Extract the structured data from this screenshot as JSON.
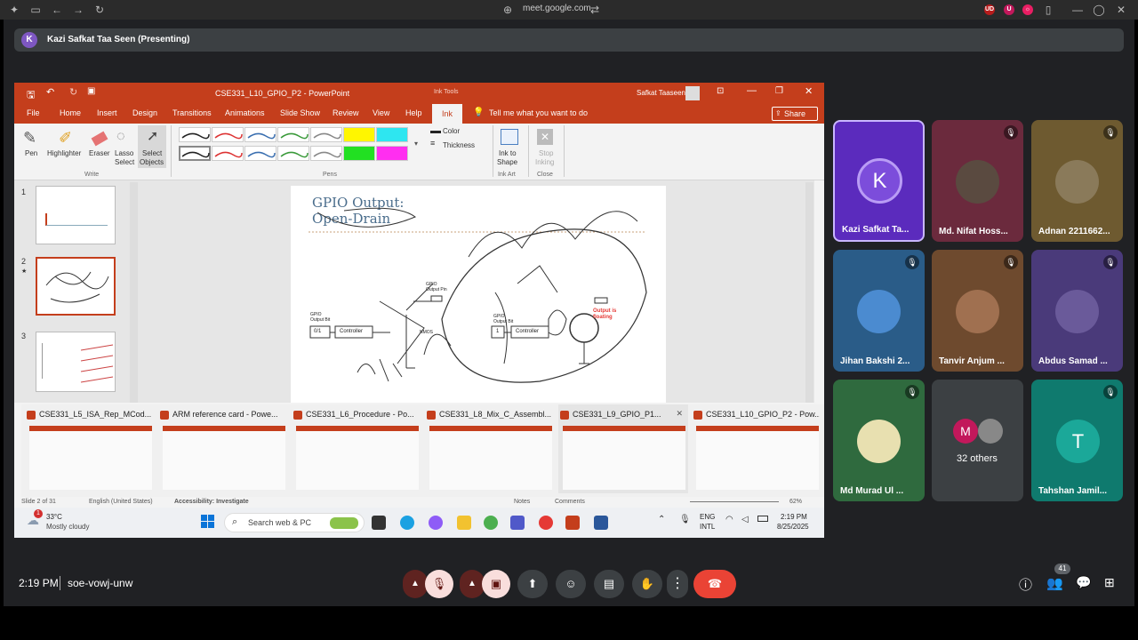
{
  "browser": {
    "url": "meet.google.com"
  },
  "meet": {
    "presenter": {
      "initial": "K",
      "label": "Kazi Safkat Taa Seen (Presenting)"
    },
    "participants": [
      {
        "name": "Kazi Safkat Ta...",
        "initial": "K"
      },
      {
        "name": "Md. Nifat Hoss..."
      },
      {
        "name": "Adnan 2211662..."
      },
      {
        "name": "Jihan Bakshi 2..."
      },
      {
        "name": "Tanvir Anjum ..."
      },
      {
        "name": "Abdus Samad ..."
      },
      {
        "name": "Md Murad Ul ..."
      },
      {
        "name": "32 others",
        "initial": "M"
      },
      {
        "name": "Tahshan Jamil...",
        "initial": "T"
      }
    ],
    "bottom": {
      "time": "2:19 PM",
      "code": "soe-vowj-unw",
      "people_count": "41"
    }
  },
  "powerpoint": {
    "filename": "CSE331_L10_GPIO_P2 - PowerPoint",
    "ink_tools": "Ink Tools",
    "user": "Safkat Taaseen",
    "tabs": [
      "File",
      "Home",
      "Insert",
      "Design",
      "Transitions",
      "Animations",
      "Slide Show",
      "Review",
      "View",
      "Help",
      "Ink"
    ],
    "tell_me": "Tell me what you want to do",
    "share": "Share",
    "ribbon": {
      "pen": "Pen",
      "highlighter": "Highlighter",
      "eraser": "Eraser",
      "lasso1": "Lasso",
      "lasso2": "Select",
      "select1": "Select",
      "select2": "Objects",
      "write_group": "Write",
      "pens_group": "Pens",
      "color": "Color",
      "thickness": "Thickness",
      "ink_to_shape1": "Ink to",
      "ink_to_shape2": "Shape",
      "ink_art_group": "Ink Art",
      "stop_inking1": "Stop",
      "stop_inking2": "Inking",
      "close_group": "Close"
    },
    "thumb_numbers": [
      "1",
      "2",
      "3"
    ],
    "slide_title_1": "GPIO Output:",
    "slide_title_2": "Open-Drain",
    "diagram_labels": {
      "gpio_bit": "GPIO",
      "output_bit": "Output Bit",
      "zero_one": "0/1",
      "controller": "Controller",
      "gpio_pin": "GPIO",
      "output_pin": "Output Pin",
      "one": "1",
      "nmos": "NMOS",
      "output_is": "Output is",
      "floating": "floating"
    },
    "taskbar_windows": [
      "CSE331_L5_ISA_Rep_MCod...",
      "ARM reference card - Powe...",
      "CSE331_L6_Procedure - Po...",
      "CSE331_L8_Mix_C_Assembl...",
      "CSE331_L9_GPIO_P1...",
      "CSE331_L10_GPIO_P2 - Pow..."
    ],
    "status": {
      "slide": "Slide 2 of 31",
      "lang": "English (United States)",
      "accessibility": "Accessibility: Investigate",
      "notes": "Notes",
      "comments": "Comments",
      "zoom": "62%"
    }
  },
  "windows": {
    "weather_temp": "33°C",
    "weather_desc": "Mostly cloudy",
    "weather_badge": "1",
    "search": "Search web & PC",
    "lang1": "ENG",
    "lang2": "INTL",
    "time": "2:19 PM",
    "date": "8/25/2025"
  },
  "colors": {
    "powerpoint": "#c43e1c",
    "meet_bg": "#202124",
    "hangup": "#ea4335",
    "muted": "#f9dedc"
  }
}
